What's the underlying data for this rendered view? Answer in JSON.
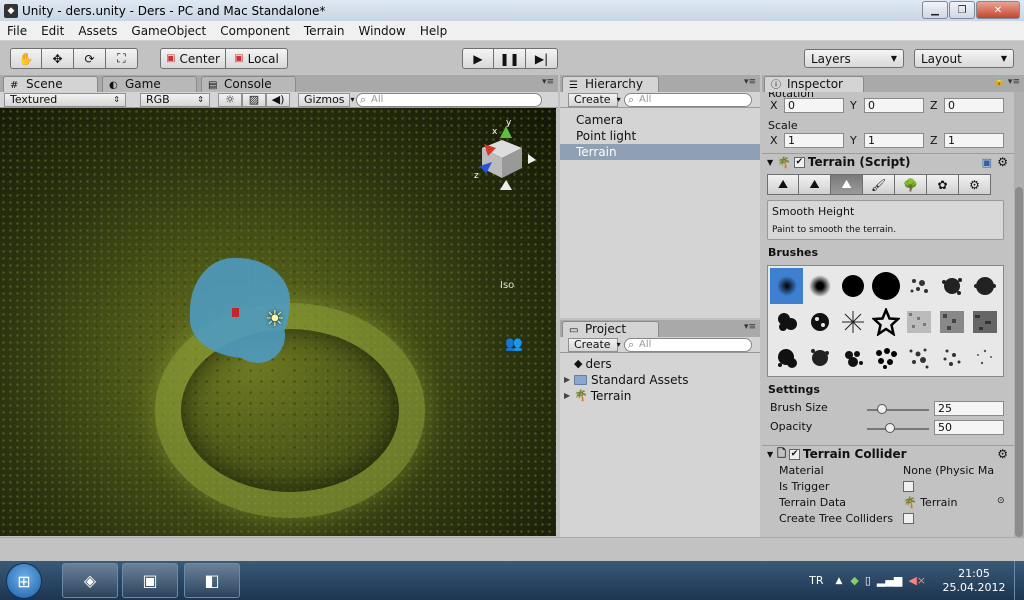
{
  "window": {
    "title": "Unity - ders.unity - Ders - PC and Mac Standalone*",
    "minimize": "▁",
    "maximize": "❐",
    "close": "✕"
  },
  "menu": [
    "File",
    "Edit",
    "Assets",
    "GameObject",
    "Component",
    "Terrain",
    "Window",
    "Help"
  ],
  "toolbar": {
    "pivot": "Center",
    "space": "Local",
    "layers": "Layers",
    "layout": "Layout"
  },
  "scene": {
    "tabs": {
      "scene": "Scene",
      "game": "Game",
      "console": "Console"
    },
    "render_mode": "Textured",
    "color_mode": "RGB",
    "gizmos": "Gizmos",
    "search_placeholder": "All",
    "view_label": "Iso",
    "axis_x": "x",
    "axis_y": "y",
    "axis_z": "z"
  },
  "hierarchy": {
    "tab": "Hierarchy",
    "create": "Create",
    "search_placeholder": "All",
    "items": [
      "Camera",
      "Point light",
      "Terrain"
    ],
    "selected_index": 2
  },
  "project": {
    "tab": "Project",
    "create": "Create",
    "search_placeholder": "All",
    "items": [
      {
        "label": "ders",
        "type": "scene"
      },
      {
        "label": "Standard Assets",
        "type": "folder"
      },
      {
        "label": "Terrain",
        "type": "terrain"
      }
    ]
  },
  "inspector": {
    "tab": "Inspector",
    "rotation_label": "Rotation",
    "rotation": {
      "x": "0",
      "y": "0",
      "z": "0"
    },
    "scale_label": "Scale",
    "scale": {
      "x": "1",
      "y": "1",
      "z": "1"
    },
    "axis_x": "X",
    "axis_y": "Y",
    "axis_z": "Z",
    "terrain_script": "Terrain (Script)",
    "tool_title": "Smooth Height",
    "tool_desc": "Paint to smooth the terrain.",
    "brushes_label": "Brushes",
    "settings_label": "Settings",
    "brush_size_label": "Brush Size",
    "brush_size": "25",
    "brush_size_fraction": 0.2,
    "opacity_label": "Opacity",
    "opacity": "50",
    "opacity_fraction": 0.35,
    "collider_title": "Terrain Collider",
    "material_label": "Material",
    "material_value": "None (Physic Ma",
    "trigger_label": "Is Trigger",
    "terrain_data_label": "Terrain Data",
    "terrain_data_value": "Terrain",
    "tree_colliders_label": "Create Tree Colliders"
  },
  "taskbar": {
    "language": "TR",
    "time": "21:05",
    "date": "25.04.2012"
  },
  "colors": {
    "selection": "#8fa0b5",
    "water": "#4f9bbf",
    "brush_selected": "#3e7fd0"
  }
}
